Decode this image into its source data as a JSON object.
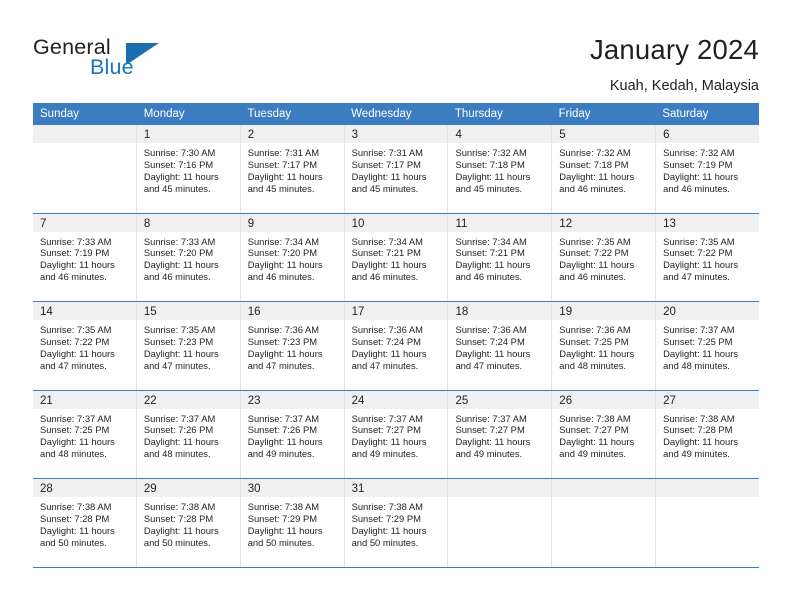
{
  "brand": {
    "word_one": "General",
    "word_two": "Blue",
    "triangle_icon": "triangle-icon",
    "accent_color": "#1b75bb"
  },
  "header": {
    "title": "January 2024",
    "location": "Kuah, Kedah, Malaysia"
  },
  "calendar": {
    "header_bg": "#3b7dc0",
    "day_band_bg": "#f0f0f0",
    "weekdays": [
      "Sunday",
      "Monday",
      "Tuesday",
      "Wednesday",
      "Thursday",
      "Friday",
      "Saturday"
    ],
    "weeks": [
      [
        {
          "day": "",
          "lines": []
        },
        {
          "day": "1",
          "lines": [
            "Sunrise: 7:30 AM",
            "Sunset: 7:16 PM",
            "Daylight: 11 hours",
            "and 45 minutes."
          ]
        },
        {
          "day": "2",
          "lines": [
            "Sunrise: 7:31 AM",
            "Sunset: 7:17 PM",
            "Daylight: 11 hours",
            "and 45 minutes."
          ]
        },
        {
          "day": "3",
          "lines": [
            "Sunrise: 7:31 AM",
            "Sunset: 7:17 PM",
            "Daylight: 11 hours",
            "and 45 minutes."
          ]
        },
        {
          "day": "4",
          "lines": [
            "Sunrise: 7:32 AM",
            "Sunset: 7:18 PM",
            "Daylight: 11 hours",
            "and 45 minutes."
          ]
        },
        {
          "day": "5",
          "lines": [
            "Sunrise: 7:32 AM",
            "Sunset: 7:18 PM",
            "Daylight: 11 hours",
            "and 46 minutes."
          ]
        },
        {
          "day": "6",
          "lines": [
            "Sunrise: 7:32 AM",
            "Sunset: 7:19 PM",
            "Daylight: 11 hours",
            "and 46 minutes."
          ]
        }
      ],
      [
        {
          "day": "7",
          "lines": [
            "Sunrise: 7:33 AM",
            "Sunset: 7:19 PM",
            "Daylight: 11 hours",
            "and 46 minutes."
          ]
        },
        {
          "day": "8",
          "lines": [
            "Sunrise: 7:33 AM",
            "Sunset: 7:20 PM",
            "Daylight: 11 hours",
            "and 46 minutes."
          ]
        },
        {
          "day": "9",
          "lines": [
            "Sunrise: 7:34 AM",
            "Sunset: 7:20 PM",
            "Daylight: 11 hours",
            "and 46 minutes."
          ]
        },
        {
          "day": "10",
          "lines": [
            "Sunrise: 7:34 AM",
            "Sunset: 7:21 PM",
            "Daylight: 11 hours",
            "and 46 minutes."
          ]
        },
        {
          "day": "11",
          "lines": [
            "Sunrise: 7:34 AM",
            "Sunset: 7:21 PM",
            "Daylight: 11 hours",
            "and 46 minutes."
          ]
        },
        {
          "day": "12",
          "lines": [
            "Sunrise: 7:35 AM",
            "Sunset: 7:22 PM",
            "Daylight: 11 hours",
            "and 46 minutes."
          ]
        },
        {
          "day": "13",
          "lines": [
            "Sunrise: 7:35 AM",
            "Sunset: 7:22 PM",
            "Daylight: 11 hours",
            "and 47 minutes."
          ]
        }
      ],
      [
        {
          "day": "14",
          "lines": [
            "Sunrise: 7:35 AM",
            "Sunset: 7:22 PM",
            "Daylight: 11 hours",
            "and 47 minutes."
          ]
        },
        {
          "day": "15",
          "lines": [
            "Sunrise: 7:35 AM",
            "Sunset: 7:23 PM",
            "Daylight: 11 hours",
            "and 47 minutes."
          ]
        },
        {
          "day": "16",
          "lines": [
            "Sunrise: 7:36 AM",
            "Sunset: 7:23 PM",
            "Daylight: 11 hours",
            "and 47 minutes."
          ]
        },
        {
          "day": "17",
          "lines": [
            "Sunrise: 7:36 AM",
            "Sunset: 7:24 PM",
            "Daylight: 11 hours",
            "and 47 minutes."
          ]
        },
        {
          "day": "18",
          "lines": [
            "Sunrise: 7:36 AM",
            "Sunset: 7:24 PM",
            "Daylight: 11 hours",
            "and 47 minutes."
          ]
        },
        {
          "day": "19",
          "lines": [
            "Sunrise: 7:36 AM",
            "Sunset: 7:25 PM",
            "Daylight: 11 hours",
            "and 48 minutes."
          ]
        },
        {
          "day": "20",
          "lines": [
            "Sunrise: 7:37 AM",
            "Sunset: 7:25 PM",
            "Daylight: 11 hours",
            "and 48 minutes."
          ]
        }
      ],
      [
        {
          "day": "21",
          "lines": [
            "Sunrise: 7:37 AM",
            "Sunset: 7:25 PM",
            "Daylight: 11 hours",
            "and 48 minutes."
          ]
        },
        {
          "day": "22",
          "lines": [
            "Sunrise: 7:37 AM",
            "Sunset: 7:26 PM",
            "Daylight: 11 hours",
            "and 48 minutes."
          ]
        },
        {
          "day": "23",
          "lines": [
            "Sunrise: 7:37 AM",
            "Sunset: 7:26 PM",
            "Daylight: 11 hours",
            "and 49 minutes."
          ]
        },
        {
          "day": "24",
          "lines": [
            "Sunrise: 7:37 AM",
            "Sunset: 7:27 PM",
            "Daylight: 11 hours",
            "and 49 minutes."
          ]
        },
        {
          "day": "25",
          "lines": [
            "Sunrise: 7:37 AM",
            "Sunset: 7:27 PM",
            "Daylight: 11 hours",
            "and 49 minutes."
          ]
        },
        {
          "day": "26",
          "lines": [
            "Sunrise: 7:38 AM",
            "Sunset: 7:27 PM",
            "Daylight: 11 hours",
            "and 49 minutes."
          ]
        },
        {
          "day": "27",
          "lines": [
            "Sunrise: 7:38 AM",
            "Sunset: 7:28 PM",
            "Daylight: 11 hours",
            "and 49 minutes."
          ]
        }
      ],
      [
        {
          "day": "28",
          "lines": [
            "Sunrise: 7:38 AM",
            "Sunset: 7:28 PM",
            "Daylight: 11 hours",
            "and 50 minutes."
          ]
        },
        {
          "day": "29",
          "lines": [
            "Sunrise: 7:38 AM",
            "Sunset: 7:28 PM",
            "Daylight: 11 hours",
            "and 50 minutes."
          ]
        },
        {
          "day": "30",
          "lines": [
            "Sunrise: 7:38 AM",
            "Sunset: 7:29 PM",
            "Daylight: 11 hours",
            "and 50 minutes."
          ]
        },
        {
          "day": "31",
          "lines": [
            "Sunrise: 7:38 AM",
            "Sunset: 7:29 PM",
            "Daylight: 11 hours",
            "and 50 minutes."
          ]
        },
        {
          "day": "",
          "lines": []
        },
        {
          "day": "",
          "lines": []
        },
        {
          "day": "",
          "lines": []
        }
      ]
    ]
  }
}
